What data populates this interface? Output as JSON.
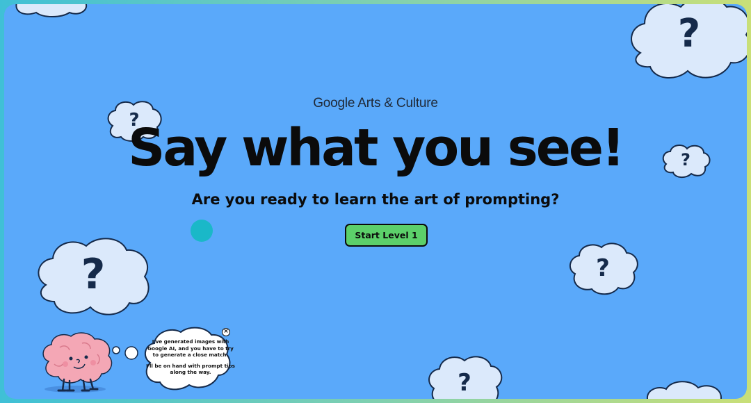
{
  "brand": {
    "google": "Google",
    "rest": " Arts & Culture"
  },
  "hero": {
    "title": "Say what you see!",
    "subtitle": "Are you ready to learn the art of prompting?",
    "start_button": "Start Level 1"
  },
  "cloud_mark": "?",
  "tip_bubble": {
    "line1": "I've generated images with Google AI, and you have to try to generate a close match.",
    "line2": "I'll be on hand with prompt tips along the way.",
    "close_glyph": "×"
  },
  "colors": {
    "background": "#5aa9fa",
    "cloud_fill": "#dbe9fb",
    "button_green": "#5cd06a",
    "accent_dot": "#1ab8c8",
    "brain_pink": "#f4a7b5"
  }
}
